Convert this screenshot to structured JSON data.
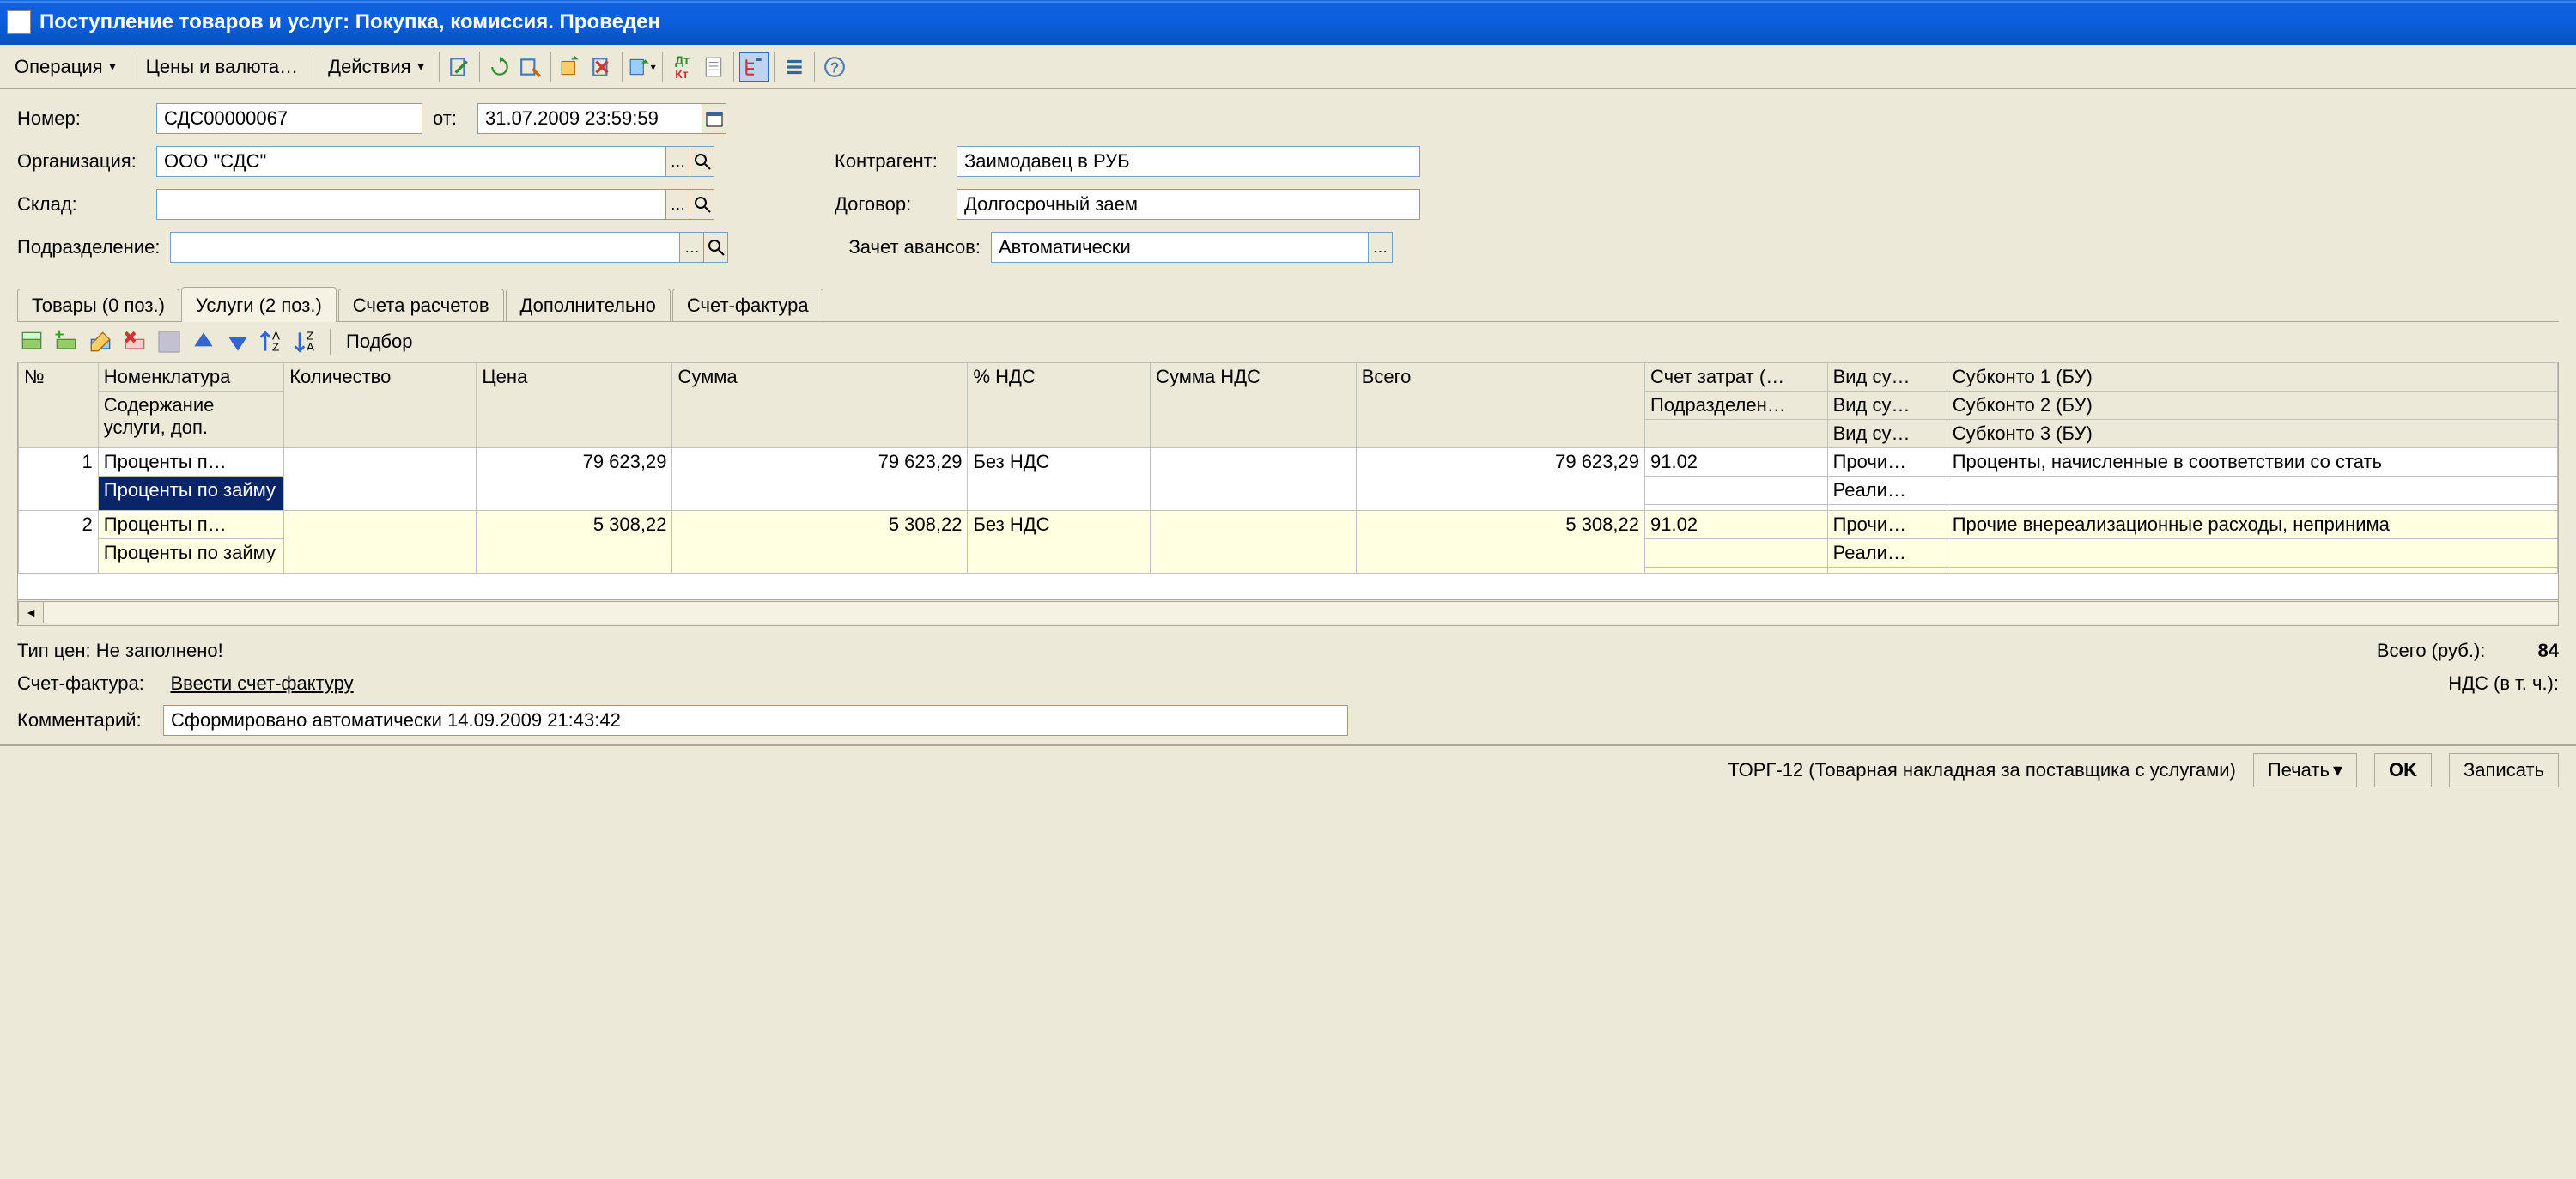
{
  "window_title": "Поступление товаров и услуг: Покупка, комиссия. Проведен",
  "toolbar": {
    "operation": "Операция",
    "prices": "Цены и валюта…",
    "actions": "Действия"
  },
  "form": {
    "number_label": "Номер:",
    "number_value": "СДС00000067",
    "from_label": "от:",
    "from_value": "31.07.2009 23:59:59",
    "org_label": "Организация:",
    "org_value": "ООО \"СДС\"",
    "warehouse_label": "Склад:",
    "warehouse_value": "",
    "dept_label": "Подразделение:",
    "dept_value": "",
    "counterparty_label": "Контрагент:",
    "counterparty_value": "Заимодавец в РУБ",
    "contract_label": "Договор:",
    "contract_value": "Долгосрочный заем",
    "advance_label": "Зачет авансов:",
    "advance_value": "Автоматически"
  },
  "tabs": {
    "goods": "Товары (0 поз.)",
    "services": "Услуги (2 поз.)",
    "accounts": "Счета расчетов",
    "additional": "Дополнительно",
    "invoice": "Счет-фактура"
  },
  "subtoolbar": {
    "selection": "Подбор"
  },
  "grid_headers": {
    "no": "№",
    "nomenclature": "Номенклатура",
    "service_desc": "Содержание услуги, доп.",
    "qty": "Количество",
    "price": "Цена",
    "sum": "Сумма",
    "vat_pct": "% НДС",
    "vat_sum": "Сумма НДС",
    "total": "Всего",
    "cost_account": "Счет затрат (…",
    "dept2": "Подразделен…",
    "vid1": "Вид су…",
    "vid2": "Вид су…",
    "vid3": "Вид су…",
    "sub1": "Субконто 1 (БУ)",
    "sub2": "Субконто 2 (БУ)",
    "sub3": "Субконто 3 (БУ)"
  },
  "grid_rows": [
    {
      "no": "1",
      "nomenclature": "Проценты п…",
      "service_desc": "Проценты по займу",
      "price": "79 623,29",
      "sum": "79 623,29",
      "vat_pct": "Без НДС",
      "total": "79 623,29",
      "cost_account": "91.02",
      "vid1": "Прочи…",
      "vid2": "Реали…",
      "sub1": "Проценты, начисленные в соответствии со стать"
    },
    {
      "no": "2",
      "nomenclature": "Проценты п…",
      "service_desc": "Проценты по займу",
      "price": "5 308,22",
      "sum": "5 308,22",
      "vat_pct": "Без НДС",
      "total": "5 308,22",
      "cost_account": "91.02",
      "vid1": "Прочи…",
      "vid2": "Реали…",
      "sub1": "Прочие внереализационные расходы, непринима"
    }
  ],
  "footer": {
    "price_type": "Тип цен: Не заполнено!",
    "total_label": "Всего (руб.):",
    "total_value": "84",
    "invoice_label": "Счет-фактура:",
    "invoice_link": "Ввести счет-фактуру",
    "vat_label": "НДС (в т. ч.):",
    "comment_label": "Комментарий:",
    "comment_value": "Сформировано автоматически 14.09.2009 21:43:42"
  },
  "bottom": {
    "torg": "ТОРГ-12 (Товарная накладная за поставщика с услугами)",
    "print": "Печать",
    "ok": "OK",
    "save": "Записать"
  }
}
